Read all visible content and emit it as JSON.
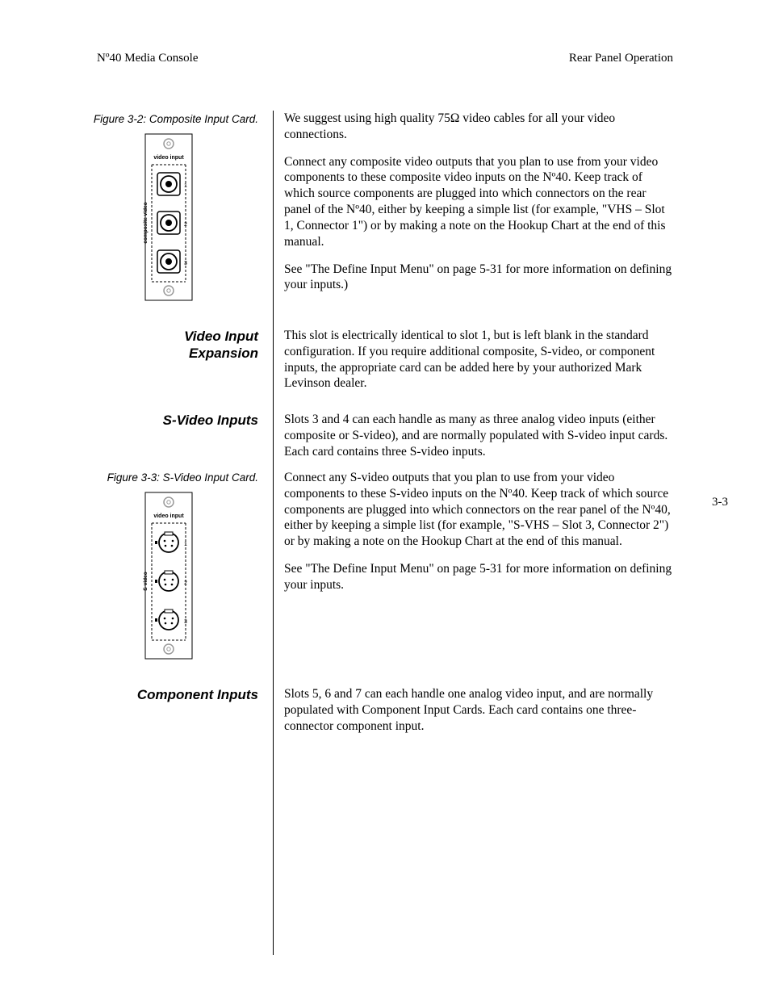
{
  "header": {
    "left": "Nº40 Media Console",
    "right": "Rear Panel Operation"
  },
  "page_number": "3-3",
  "fig32": {
    "caption": "Figure 3-2: Composite Input Card.",
    "label_top": "video input",
    "label_side": "composite video",
    "nums": [
      "1",
      "2",
      "3"
    ]
  },
  "fig33": {
    "caption": "Figure 3-3: S-Video Input Card.",
    "label_top": "video input",
    "label_side": "S-video",
    "nums": [
      "1",
      "2",
      "3"
    ]
  },
  "sections": {
    "top": {
      "p1": "We suggest using high quality 75Ω video cables for all your video connections.",
      "p2": "Connect any composite video outputs that you plan to use from your video components to these composite video inputs on the Nº40. Keep track of which source components are plugged into which connectors on the rear panel of the Nº40, either by keeping a simple list (for example, \"VHS – Slot 1, Connector 1\") or by making a note on the Hookup Chart at the end of this manual.",
      "p3": "See \"The Define Input Menu\" on page 5-31 for more information on defining your inputs.)"
    },
    "video_input_expansion": {
      "heading1": "Video Input",
      "heading2": "Expansion",
      "p1": "This slot is electrically identical to slot 1, but is left blank in the standard configuration. If you require additional composite, S-video, or component inputs, the appropriate card can be added here by your authorized Mark Levinson dealer."
    },
    "svideo": {
      "heading": "S-Video Inputs",
      "p1": "Slots 3 and 4 can each handle as many as three analog video inputs (either composite or S-video), and are normally populated with S-video input cards. Each card contains three S-video inputs.",
      "p2": "Connect any S-video outputs that you plan to use from your video components to these S-video inputs on the Nº40. Keep track of which source components are plugged into which connectors on the rear panel of the Nº40, either by keeping a simple list (for example, \"S-VHS – Slot 3, Connector 2\") or by making a note on the Hookup Chart at the end of this manual.",
      "p3": "See \"The Define Input Menu\" on page 5-31 for more information on defining your inputs."
    },
    "component": {
      "heading": "Component Inputs",
      "p1": "Slots 5, 6 and 7 can each handle one analog video input, and are normally populated with Component Input Cards. Each card contains one three-connector component input."
    }
  }
}
